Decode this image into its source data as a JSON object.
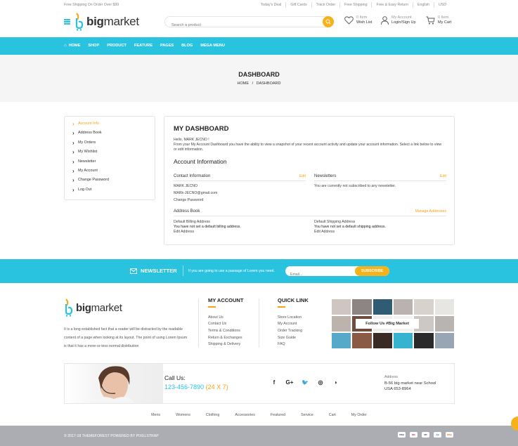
{
  "topbar": {
    "promo": "Free Shipping On Order Over $99",
    "links": [
      "Today's Deal",
      "Gift Cards",
      "Track Order",
      "Free Shipping",
      "Free & Easy Return",
      "English",
      "USD"
    ]
  },
  "header": {
    "logo_b": "big",
    "logo_m": "market",
    "search_placeholder": "Search a product",
    "wishlist_count": "0 Item",
    "wishlist_label": "Wish List",
    "account_top": "My Account",
    "account_label": "Login/Sign Up",
    "cart_count": "0 Item",
    "cart_label": "My Cart"
  },
  "nav": {
    "items": [
      "HOME",
      "SHOP",
      "PRODUCT",
      "FEATURE",
      "PAGES",
      "BLOG",
      "MEGA MENU"
    ]
  },
  "page": {
    "title": "DASHBOARD",
    "crumb_home": "HOME",
    "crumb_sep": "/",
    "crumb_current": "DASHBOARD"
  },
  "sidebar": {
    "items": [
      "Account Info",
      "Address Book",
      "My Orders",
      "My Wishlist",
      "Newsletter",
      "My Account",
      "Change Password",
      "Log Out"
    ]
  },
  "dashboard": {
    "title": "MY DASHBOARD",
    "hello": "Hello, MARK JECNO !",
    "intro": "From your My Account Dashboard you have the ability to view a snapshot of your recent account activity and update your account information. Select a link below to view or edit information.",
    "account_info_title": "Account Information",
    "contact_title": "Contact Information",
    "edit": "Edit",
    "contact_name": "MARK JECNO",
    "contact_email": "MARk-JECNO@gmail.com",
    "change_password": "Change Password",
    "newsletters_title": "Newsletters",
    "newsletters_text": "You are currently not subscribed to any newsletter.",
    "address_book_title": "Address Book",
    "manage_addresses": "Manage Addresses",
    "billing_title": "Default Billing Address",
    "billing_text": "You have not set a default billing address.",
    "shipping_title": "Default Shipping Address",
    "shipping_text": "You have not set a default shipping address.",
    "edit_address": "Edit Address"
  },
  "newsletter": {
    "title": "NEWSLETTER",
    "text": "If you are going to use a passage of Lorem you need.",
    "placeholder": "Email...",
    "button": "SUBSCRIBE"
  },
  "footer": {
    "about": "It is a long established fact that a reader will be distracted by the readable content of a page when looking at its layout. The point of using Lorem Ipsum is that it has a more-or-less normal distribution",
    "my_account_title": "MY ACCOUNT",
    "my_account_links": [
      "About Us",
      "Contact Us",
      "Terms & Conditions",
      "Return & Exchanges",
      "Shipping & Delivery"
    ],
    "quick_link_title": "QUICK LINK",
    "quick_links": [
      "Store Location",
      "My Account",
      "Order Tracking",
      "Size Guide",
      "FAQ"
    ],
    "instagram_tag": "Follow Us #Big Market",
    "call_label": "Call Us:",
    "phone": "123-456-7890",
    "phone_hours": "(24 X 7)",
    "social": [
      "f",
      "G+",
      "🐦",
      "◎",
      "◗"
    ],
    "address_label": "Address",
    "address_line1": "B-56 big market near School",
    "address_line2": "USA 653-8964",
    "bottom_links": [
      "Mens",
      "Womens",
      "Clothing",
      "Accessories",
      "Featured",
      "Service",
      "Cart",
      "My Order"
    ],
    "copyright": "© 2017-18 THEMEFOREST POWERED BY PIXELSTRAP",
    "cards": [
      "VISA",
      "MC",
      "PP",
      "AE",
      "DISC"
    ]
  },
  "colors": {
    "accent": "#29c3e0",
    "orange": "#f7a21a"
  }
}
